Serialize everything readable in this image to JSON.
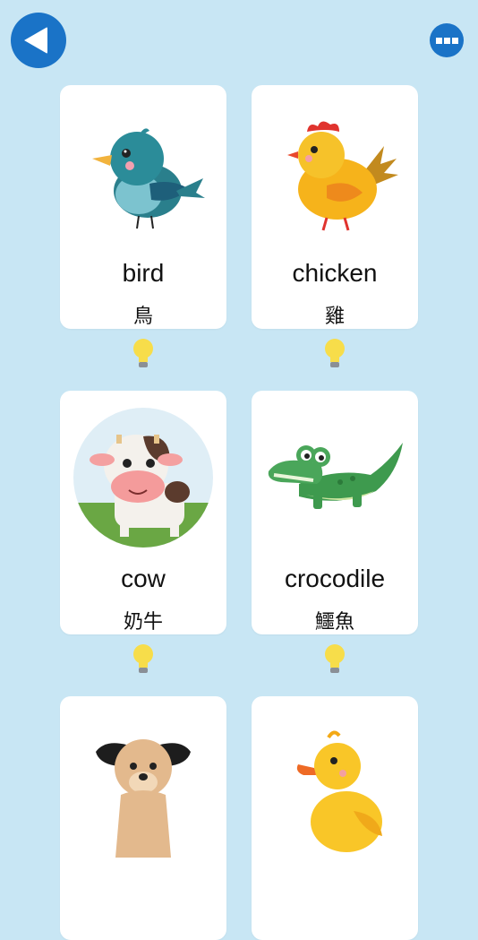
{
  "header": {
    "back_icon": "back-triangle-icon",
    "menu_icon": "more-dots-icon",
    "accent": "#1a73c7",
    "background": "#c8e6f4"
  },
  "cards": [
    {
      "en": "bird",
      "zh": "鳥",
      "icon": "bird-icon"
    },
    {
      "en": "chicken",
      "zh": "雞",
      "icon": "chicken-icon"
    },
    {
      "en": "cow",
      "zh": "奶牛",
      "icon": "cow-icon"
    },
    {
      "en": "crocodile",
      "zh": "鱷魚",
      "icon": "crocodile-icon"
    },
    {
      "en": "",
      "zh": "",
      "icon": "dog-icon"
    },
    {
      "en": "",
      "zh": "",
      "icon": "duck-icon"
    }
  ],
  "hint_icon": "lightbulb-icon"
}
